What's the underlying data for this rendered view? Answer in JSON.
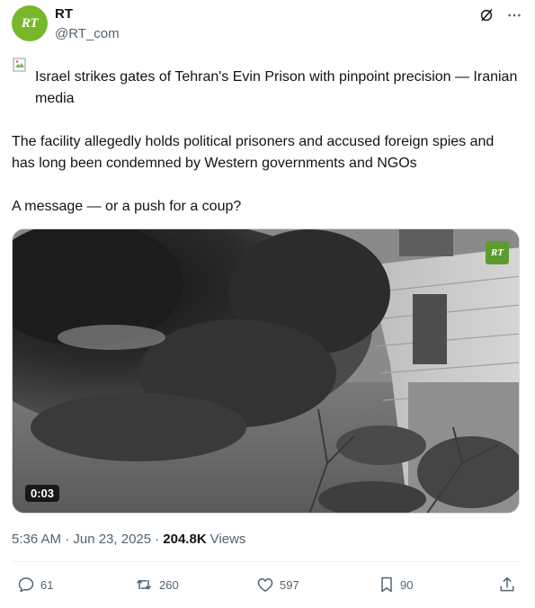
{
  "account": {
    "name": "RT",
    "handle": "@RT_com",
    "avatar_monogram": "RT",
    "avatar_color": "#77b82a"
  },
  "header_icons": [
    "grok-icon",
    "more-icon"
  ],
  "post": {
    "headline": "Israel strikes gates of Tehran's Evin Prison with pinpoint precision — Iranian media",
    "paragraph": "The facility allegedly holds political prisoners and accused foreign spies and has long been condemned by Western governments and NGOs",
    "question": "A message — or a push for a coup?"
  },
  "media": {
    "watermark": "RT",
    "duration": "0:03"
  },
  "meta": {
    "timestamp": "5:36 AM · Jun 23, 2025 ·",
    "views_count": "204.8K",
    "views_label": "Views"
  },
  "actions": {
    "replies": "61",
    "reposts": "260",
    "likes": "597",
    "bookmarks": "90"
  },
  "colors": {
    "text": "#0f1419",
    "secondary": "#536471",
    "rt_green": "#77b82a"
  }
}
